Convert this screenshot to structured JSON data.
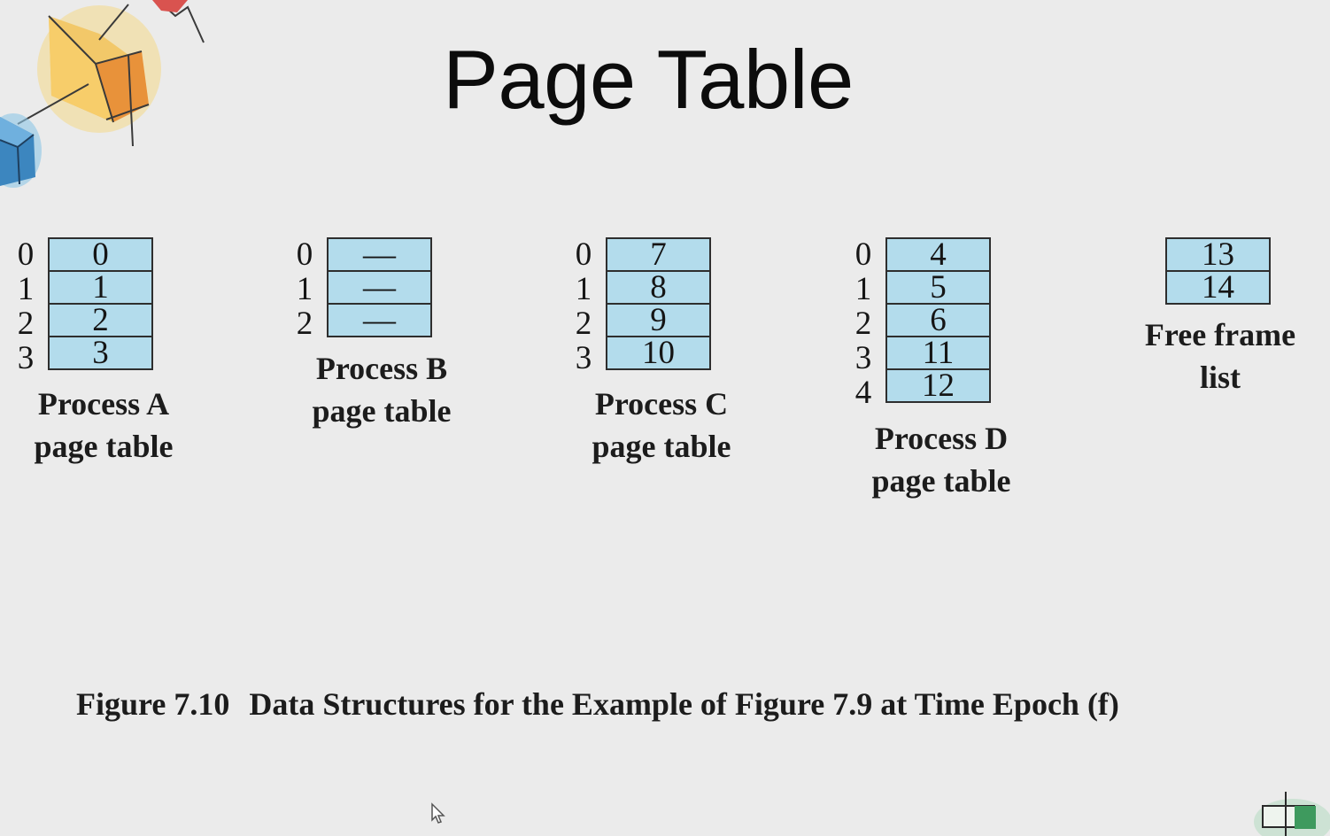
{
  "slide": {
    "title": "Page Table"
  },
  "tables": [
    {
      "id": "a",
      "indices": [
        "0",
        "1",
        "2",
        "3"
      ],
      "frames": [
        "0",
        "1",
        "2",
        "3"
      ],
      "caption_line1": "Process A",
      "caption_line2": "page table"
    },
    {
      "id": "b",
      "indices": [
        "0",
        "1",
        "2"
      ],
      "frames": [
        "—",
        "—",
        "—"
      ],
      "caption_line1": "Process B",
      "caption_line2": "page table"
    },
    {
      "id": "c",
      "indices": [
        "0",
        "1",
        "2",
        "3"
      ],
      "frames": [
        "7",
        "8",
        "9",
        "10"
      ],
      "caption_line1": "Process C",
      "caption_line2": "page table"
    },
    {
      "id": "d",
      "indices": [
        "0",
        "1",
        "2",
        "3",
        "4"
      ],
      "frames": [
        "4",
        "5",
        "6",
        "11",
        "12"
      ],
      "caption_line1": "Process D",
      "caption_line2": "page table"
    }
  ],
  "free_frame_list": {
    "frames": [
      "13",
      "14"
    ],
    "caption_line1": "Free frame",
    "caption_line2": "list"
  },
  "figure_caption": {
    "number": "Figure 7.10",
    "text": "Data Structures for the Example of Figure 7.9 at Time Epoch (f)"
  },
  "colors": {
    "cell_fill": "#b3dcec",
    "cell_border": "#2e2e2e",
    "background": "#ebebeb"
  }
}
